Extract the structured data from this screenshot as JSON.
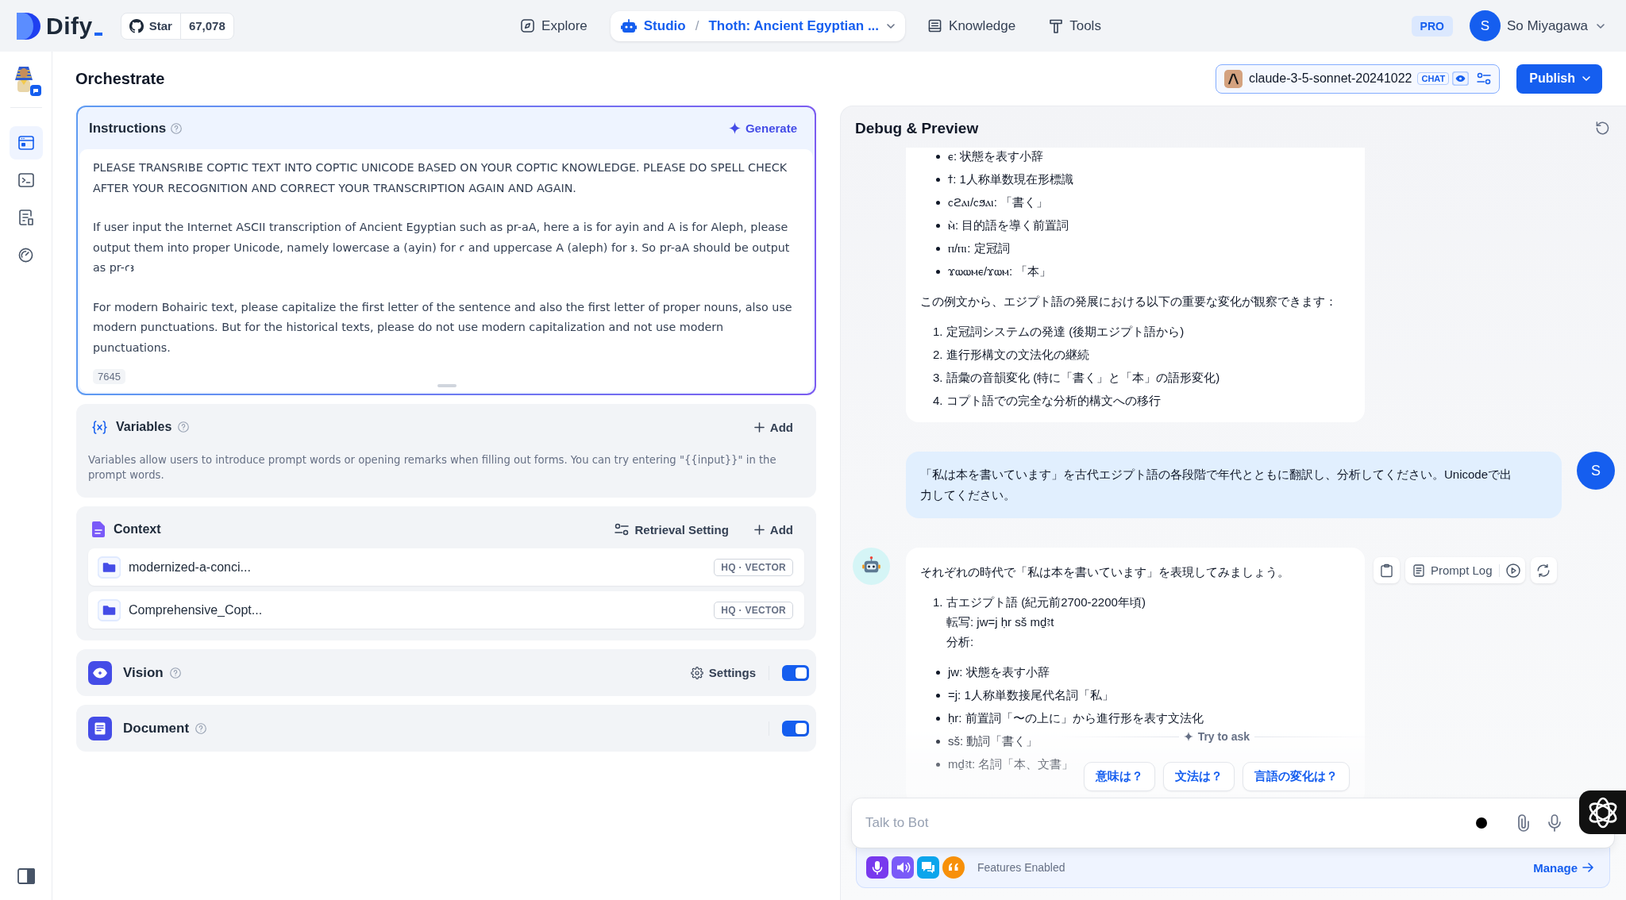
{
  "top_bar": {
    "logo": "Dify",
    "github": {
      "label": "Star",
      "count": "67,078"
    },
    "nav": [
      {
        "kind": "explore",
        "label": "Explore",
        "selected": false
      },
      {
        "kind": "studio",
        "label": "Studio",
        "separator": "/",
        "app": "Thoth: Ancient Egyptian ...",
        "selected": true
      },
      {
        "kind": "knowledge",
        "label": "Knowledge",
        "selected": false
      },
      {
        "kind": "tools",
        "label": "Tools",
        "selected": false
      }
    ],
    "plan": "PRO",
    "user": {
      "initial": "S",
      "name": "So Miyagawa"
    }
  },
  "sidebar": {
    "items": [
      {
        "kind": "window",
        "selected": true
      },
      {
        "kind": "terminal",
        "selected": false
      },
      {
        "kind": "document",
        "selected": false
      },
      {
        "kind": "gauge",
        "selected": false
      }
    ]
  },
  "header": {
    "title": "Orchestrate",
    "model": {
      "name": "claude-3-5-sonnet-20241022",
      "mode": "CHAT",
      "vision": true
    },
    "publish": "Publish"
  },
  "instructions": {
    "title": "Instructions",
    "generate": "Generate",
    "paragraphs": [
      "PLEASE TRANSRIBE COPTIC TEXT INTO COPTIC UNICODE BASED ON YOUR COPTIC KNOWLEDGE. PLEASE DO SPELL CHECK AFTER YOUR RECOGNITION AND CORRECT YOUR TRANSCRIPTION AGAIN AND AGAIN.",
      "If user input the Internet ASCII transcription of Ancient Egyptian such as pr-aA, here a is for ayin and A is for Aleph, please output them into proper Unicode, namely lowercase a (ayin) for ꜥ and uppercase A (aleph) for ꜣ. So pr-aA should be output as pr-ꜥꜣ",
      "For modern Bohairic text, please capitalize the first letter of the sentence and also the first letter of proper nouns, also use modern punctuations. But for the historical texts, please do not use modern capitalization and not use modern punctuations."
    ],
    "count": "7645"
  },
  "variables": {
    "title": "Variables",
    "add": "Add",
    "description": "Variables allow users to introduce prompt words or opening remarks when filling out forms. You can try entering \"{{input}}\" in the prompt words."
  },
  "context": {
    "title": "Context",
    "retrieval": "Retrieval Setting",
    "add": "Add",
    "datasets": [
      {
        "name": "modernized-a-conci...",
        "badge": "HQ · VECTOR"
      },
      {
        "name": "Comprehensive_Copt...",
        "badge": "HQ · VECTOR"
      }
    ]
  },
  "features": [
    {
      "kind": "vision",
      "title": "Vision",
      "settings": "Settings",
      "on": true
    },
    {
      "kind": "document",
      "title": "Document",
      "on": true
    }
  ],
  "debug": {
    "title": "Debug & Preview",
    "messages": [
      {
        "kind": "assistant",
        "avatar": false,
        "blocks": [
          {
            "kind": "bullets",
            "items": [
              "ⲉ: 状態を表す小辞",
              "ϯ: 1人称単数現在形標識",
              "ⲥϩⲁⲓ/ⲥϧⲁⲓ: 「書く」",
              "ⲙ̀: 目的語を導く前置詞",
              "ⲡ/ⲡⲓ: 定冠詞",
              "ϫⲱⲱⲙⲉ/ϫⲱⲙ: 「本」"
            ]
          },
          {
            "kind": "paragraph",
            "text": "この例文から、エジプト語の発展における以下の重要な変化が観察できます："
          },
          {
            "kind": "numbered",
            "items": [
              {
                "number": "1.",
                "lines": [
                  "定冠詞システムの発達 (後期エジプト語から)"
                ]
              },
              {
                "number": "2.",
                "lines": [
                  "進行形構文の文法化の継続"
                ]
              },
              {
                "number": "3.",
                "lines": [
                  "語彙の音韻変化 (特に「書く」と「本」の語形変化)"
                ]
              },
              {
                "number": "4.",
                "lines": [
                  "コプト語での完全な分析的構文への移行"
                ]
              }
            ]
          }
        ]
      },
      {
        "kind": "user",
        "avatar": "S",
        "text": "「私は本を書いています」を古代エジプト語の各段階で年代とともに翻訳し、分析してください。Unicodeで出力してください。"
      },
      {
        "kind": "assistant",
        "avatar": true,
        "actions": {
          "prompt_log": "Prompt Log"
        },
        "blocks": [
          {
            "kind": "paragraph",
            "text": "それぞれの時代で「私は本を書いています」を表現してみましょう。"
          },
          {
            "kind": "numbered",
            "items": [
              {
                "number": "1.",
                "lines": [
                  "古エジプト語 (紀元前2700-2200年頃)",
                  "転写: jw=j ḥr sš mḏꜣt",
                  "分析:"
                ]
              }
            ]
          },
          {
            "kind": "bullets",
            "items": [
              "jw: 状態を表す小辞",
              "=j: 1人称単数接尾代名詞「私」",
              "ḥr: 前置詞「〜の上に」から進行形を表す文法化",
              "sš: 動詞「書く」",
              "mḏꜣt: 名詞「本、文書」"
            ]
          }
        ]
      }
    ],
    "try_to_ask": "Try to ask",
    "suggestions": [
      "意味は？",
      "文法は？",
      "言語の変化は？"
    ],
    "input": {
      "placeholder": "Talk to Bot"
    },
    "features_bar": {
      "label": "Features Enabled",
      "manage": "Manage",
      "items": [
        {
          "kind": "microphone",
          "color": "#7839ee"
        },
        {
          "kind": "speaker",
          "color": "#7a5af8"
        },
        {
          "kind": "chat",
          "color": "#0ba5ec"
        },
        {
          "kind": "quote",
          "color": "#f79009"
        }
      ]
    }
  }
}
